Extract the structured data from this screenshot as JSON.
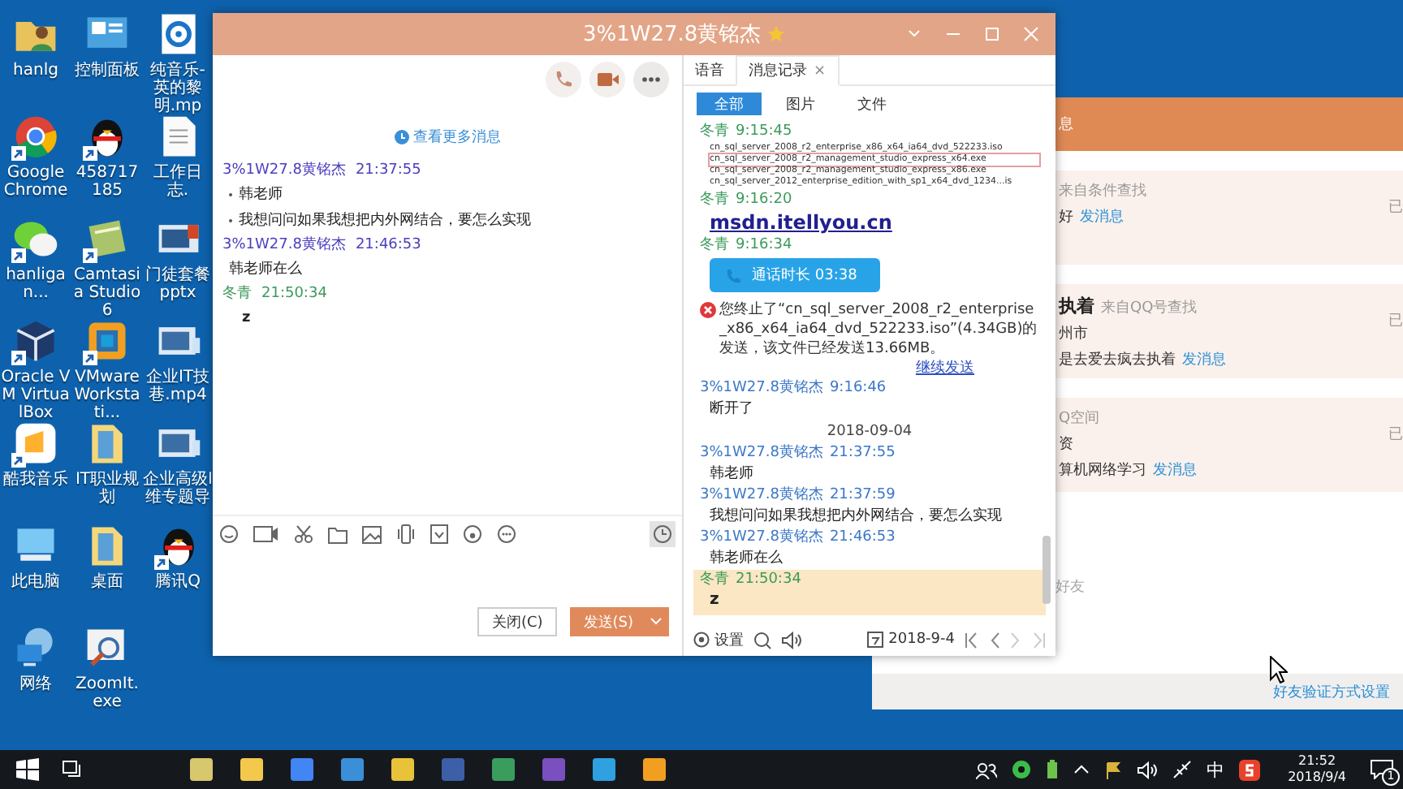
{
  "desktop_icons": [
    {
      "label": "hanlg",
      "kind": "userfolder",
      "shortcut": false
    },
    {
      "label": "Google Chrome",
      "kind": "browser",
      "shortcut": true
    },
    {
      "label": "hanligan...",
      "kind": "chat",
      "shortcut": true
    },
    {
      "label": "Oracle VM VirtualBox",
      "kind": "cube",
      "shortcut": true
    },
    {
      "label": "酷我音乐",
      "kind": "music",
      "shortcut": true
    },
    {
      "label": "此电脑",
      "kind": "pc",
      "shortcut": false
    },
    {
      "label": "网络",
      "kind": "network",
      "shortcut": false
    },
    {
      "label": "控制面板",
      "kind": "panel",
      "shortcut": false
    },
    {
      "label": "458717185",
      "kind": "penguin",
      "shortcut": true
    },
    {
      "label": "Camtasia Studio 6",
      "kind": "app",
      "shortcut": true
    },
    {
      "label": "VMware Workstati...",
      "kind": "vm",
      "shortcut": true
    },
    {
      "label": "IT职业规划",
      "kind": "folder",
      "shortcut": false
    },
    {
      "label": "桌面",
      "kind": "folder",
      "shortcut": false
    },
    {
      "label": "ZoomIt.exe",
      "kind": "magnifier",
      "shortcut": false
    },
    {
      "label": "纯音乐-英的黎明.mp",
      "kind": "disc",
      "shortcut": false
    },
    {
      "label": "工作日志.",
      "kind": "document",
      "shortcut": false
    },
    {
      "label": "门徒套餐pptx",
      "kind": "slides",
      "shortcut": false
    },
    {
      "label": "企业IT技巷.mp4",
      "kind": "video",
      "shortcut": false
    },
    {
      "label": "企业高级I维专题导",
      "kind": "video",
      "shortcut": false
    },
    {
      "label": "腾讯Q",
      "kind": "penguin",
      "shortcut": true
    }
  ],
  "background_window": {
    "header": "息",
    "requests": [
      {
        "source": "来自条件查找",
        "message": "好",
        "action": "发消息",
        "status": "已"
      },
      {
        "name": "执着",
        "source": "来自QQ号查找",
        "location": "州市",
        "message": "是去爱去疯去执着",
        "action": "发消息",
        "status": "已"
      },
      {
        "source": "Q空间",
        "location": "资",
        "message": "算机网络学习",
        "action": "发消息",
        "status": "已"
      }
    ],
    "hint": "好友",
    "footer_link": "好友验证方式设置"
  },
  "chat_window": {
    "title": "3%1W27.8黄铭杰",
    "more_messages": "查看更多消息",
    "messages": [
      {
        "sender": "3%1W27.8黄铭杰",
        "time": "21:37:55",
        "self": false,
        "bulleted": true,
        "lines": [
          "韩老师",
          "我想问问如果我想把内外网结合，要怎么实现"
        ]
      },
      {
        "sender": "3%1W27.8黄铭杰",
        "time": "21:46:53",
        "self": false,
        "bulleted": false,
        "lines": [
          "韩老师在么"
        ]
      },
      {
        "sender": "冬青",
        "time": "21:50:34",
        "self": true,
        "bulleted": false,
        "lines": [
          "z"
        ]
      }
    ],
    "close_button": "关闭(C)",
    "send_button": "发送(S)",
    "history": {
      "tabs": [
        {
          "label": "语音",
          "selected": false,
          "closable": false
        },
        {
          "label": "消息记录",
          "selected": true,
          "closable": true
        }
      ],
      "close_mark": "×",
      "filters": [
        {
          "label": "全部",
          "selected": true
        },
        {
          "label": "图片",
          "selected": false
        },
        {
          "label": "文件",
          "selected": false
        }
      ],
      "entries": [
        {
          "kind": "files",
          "sender": "冬青",
          "time": "9:15:45",
          "self": true,
          "highlighted": false,
          "files": [
            "cn_sql_server_2008_r2_enterprise_x86_x64_ia64_dvd_522233.iso",
            "cn_sql_server_2008_r2_management_studio_express_x64.exe",
            "cn_sql_server_2008_r2_management_studio_express_x86.exe",
            "cn_sql_server_2012_enterprise_edition_with_sp1_x64_dvd_1234...is"
          ]
        },
        {
          "kind": "link",
          "sender": "冬青",
          "time": "9:16:20",
          "self": true,
          "highlighted": false,
          "text": "msdn.itellyou.cn"
        },
        {
          "kind": "call",
          "sender": "冬青",
          "time": "9:16:34",
          "self": true,
          "highlighted": false,
          "text": "通话时长 03:38"
        },
        {
          "kind": "notice",
          "text": "您终止了“cn_sql_server_2008_r2_enterprise_x86_x64_ia64_dvd_522233.iso”(4.34GB)的发送，该文件已经发送13.66MB。",
          "action": "继续发送"
        },
        {
          "kind": "text",
          "sender": "3%1W27.8黄铭杰",
          "time": "9:16:46",
          "self": false,
          "highlighted": false,
          "text": "断开了"
        },
        {
          "kind": "date",
          "text": "2018-09-04"
        },
        {
          "kind": "text",
          "sender": "3%1W27.8黄铭杰",
          "time": "21:37:55",
          "self": false,
          "highlighted": false,
          "text": "韩老师"
        },
        {
          "kind": "text",
          "sender": "3%1W27.8黄铭杰",
          "time": "21:37:59",
          "self": false,
          "highlighted": false,
          "text": "我想问问如果我想把内外网结合，要怎么实现"
        },
        {
          "kind": "text",
          "sender": "3%1W27.8黄铭杰",
          "time": "21:46:53",
          "self": false,
          "highlighted": false,
          "text": "韩老师在么"
        },
        {
          "kind": "text",
          "sender": "冬青",
          "time": "21:50:34",
          "self": true,
          "highlighted": true,
          "text": "z"
        }
      ],
      "settings": "设置",
      "date": "2018-9-4"
    }
  },
  "taskbar": {
    "ime": "中",
    "time": "21:52",
    "date": "2018/9/4",
    "notifications": "1"
  }
}
